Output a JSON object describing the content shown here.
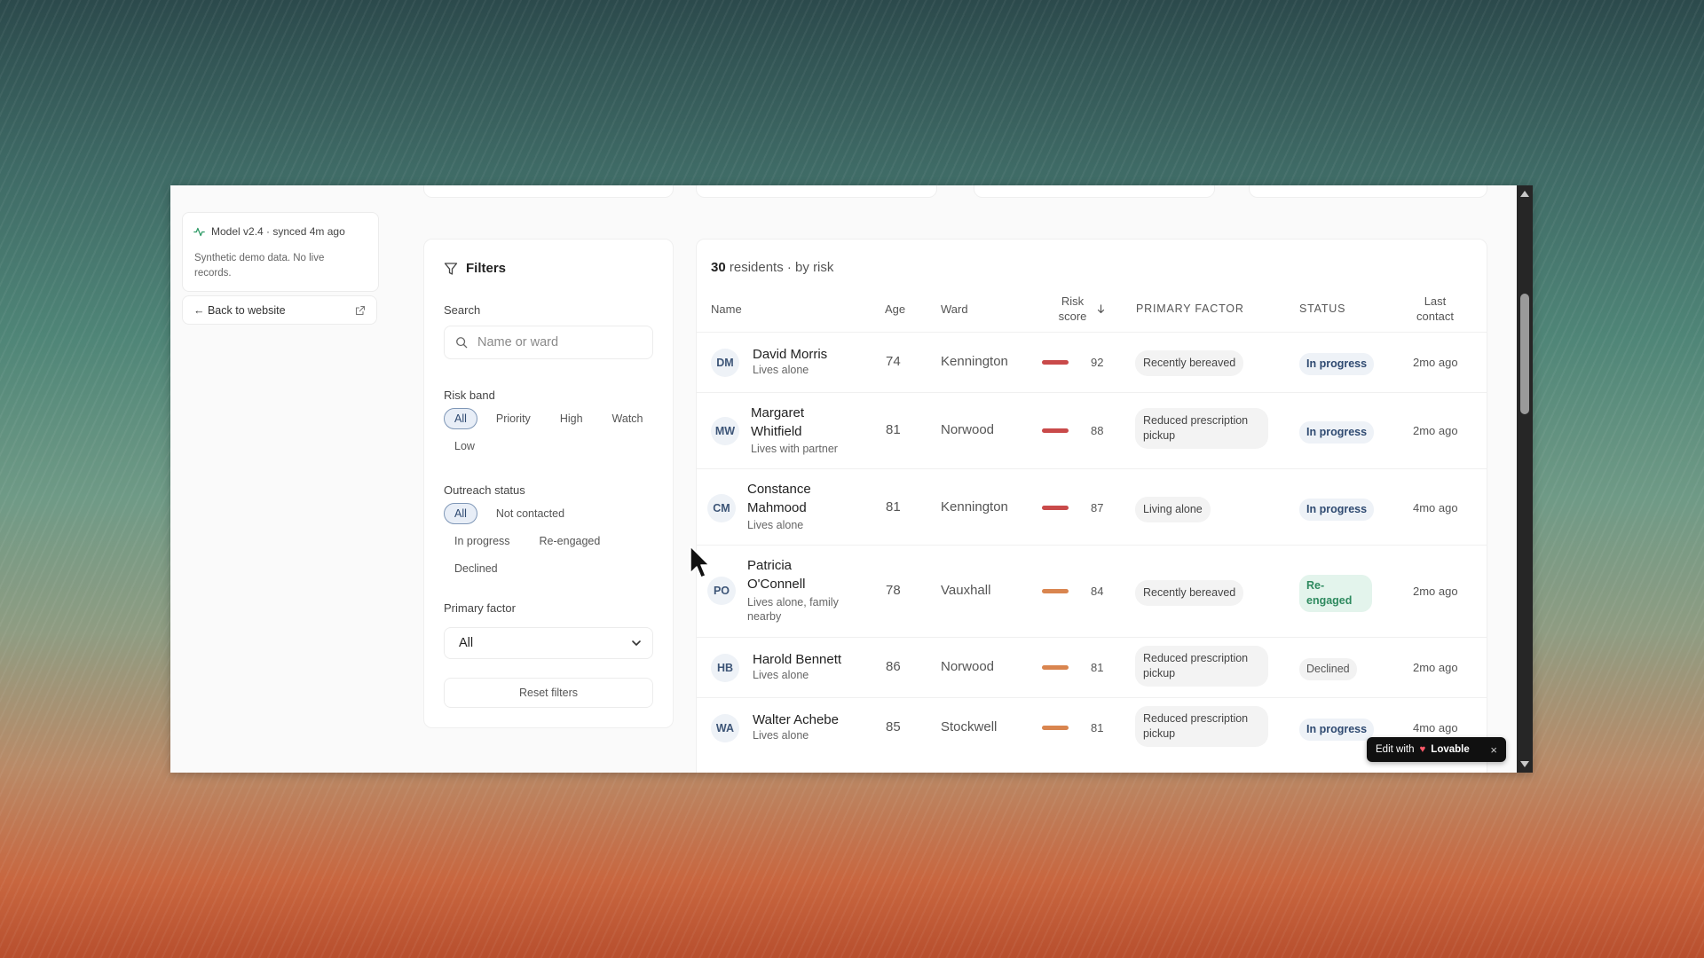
{
  "sidebar": {
    "model_status": "Model v2.4 · synced 4m ago",
    "model_note": "Synthetic demo data. No live records.",
    "back_link": "← Back to website"
  },
  "filters": {
    "title": "Filters",
    "search_label": "Search",
    "search_placeholder": "Name or ward",
    "risk_band_label": "Risk band",
    "risk_band_options": [
      "All",
      "Priority",
      "High",
      "Watch",
      "Low"
    ],
    "risk_band_selected": "All",
    "outreach_label": "Outreach status",
    "outreach_options": [
      "All",
      "Not contacted",
      "In progress",
      "Re-engaged",
      "Declined"
    ],
    "outreach_selected": "All",
    "primary_factor_label": "Primary factor",
    "primary_factor_value": "All",
    "reset_label": "Reset filters"
  },
  "table": {
    "count": "30",
    "title_suffix": "residents · by risk",
    "columns": {
      "name": "Name",
      "age": "Age",
      "ward": "Ward",
      "risk": "Risk score",
      "factor": "PRIMARY FACTOR",
      "status": "STATUS",
      "last": "Last contact"
    },
    "rows": [
      {
        "initials": "DM",
        "name": "David Morris",
        "living": "Lives alone",
        "age": "74",
        "ward": "Kennington",
        "score": "92",
        "bar_color": "#c94a4a",
        "factor": "Recently bereaved",
        "status": "In progress",
        "status_kind": "prog",
        "last": "2mo ago"
      },
      {
        "initials": "MW",
        "name": "Margaret Whitfield",
        "living": "Lives with partner",
        "age": "81",
        "ward": "Norwood",
        "score": "88",
        "bar_color": "#c94a4a",
        "factor": "Reduced prescription pickup",
        "status": "In progress",
        "status_kind": "prog",
        "last": "2mo ago"
      },
      {
        "initials": "CM",
        "name": "Constance Mahmood",
        "living": "Lives alone",
        "age": "81",
        "ward": "Kennington",
        "score": "87",
        "bar_color": "#c94a4a",
        "factor": "Living alone",
        "status": "In progress",
        "status_kind": "prog",
        "last": "4mo ago"
      },
      {
        "initials": "PO",
        "name": "Patricia O'Connell",
        "living": "Lives alone, family nearby",
        "age": "78",
        "ward": "Vauxhall",
        "score": "84",
        "bar_color": "#d9854f",
        "factor": "Recently bereaved",
        "status": "Re-engaged",
        "status_kind": "reeng",
        "last": "2mo ago"
      },
      {
        "initials": "HB",
        "name": "Harold Bennett",
        "living": "Lives alone",
        "age": "86",
        "ward": "Norwood",
        "score": "81",
        "bar_color": "#d9854f",
        "factor": "Reduced prescription pickup",
        "status": "Declined",
        "status_kind": "decl",
        "last": "2mo ago"
      },
      {
        "initials": "WA",
        "name": "Walter Achebe",
        "living": "Lives alone",
        "age": "85",
        "ward": "Stockwell",
        "score": "81",
        "bar_color": "#d9854f",
        "factor": "Reduced prescription pickup",
        "status": "In progress",
        "status_kind": "prog",
        "last": "4mo ago"
      }
    ]
  },
  "badge": {
    "prefix": "Edit with",
    "brand": "Lovable",
    "close": "×"
  },
  "icons": [
    "activity-icon",
    "external-link-icon",
    "filter-icon",
    "search-icon",
    "chevron-down-icon",
    "sort-down-icon",
    "cursor-icon",
    "close-icon"
  ]
}
